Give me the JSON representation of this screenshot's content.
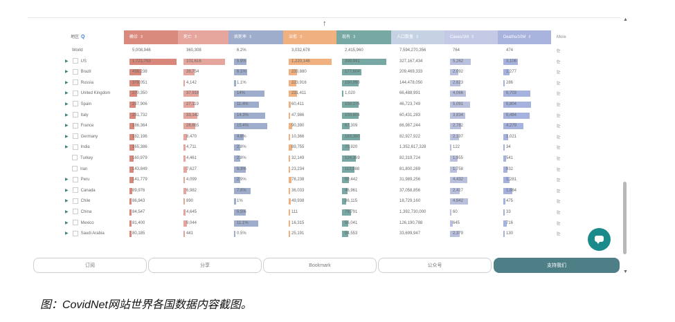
{
  "caption": "图：CovidNet网站世界各国数据内容截图。",
  "colors": {
    "cases": "#d9877a",
    "deaths": "#e5a49c",
    "fatality": "#9eadcc",
    "recovered": "#f0b07f",
    "active": "#77a8a3",
    "population": "#b8c6d9",
    "cases_per_m": "#b8c0de",
    "deaths_per_m": "#a6b2de",
    "support_btn": "#4f7f86",
    "fab": "#1a8a8a"
  },
  "table": {
    "headers": {
      "region": "地区",
      "cases": "确诊",
      "deaths": "死亡",
      "fatality": "病死率",
      "recovered": "治愈",
      "active": "现有",
      "population": "人口数量",
      "cases_per_m": "Cases/1M",
      "deaths_per_m": "Deaths/10M",
      "more": "More"
    },
    "rows": [
      {
        "name": "World",
        "cases": "5,008,946",
        "deaths": "360,308",
        "fatality": "6.2%",
        "recovered": "3,032,678",
        "active": "2,415,960",
        "population": "7,594,270,356",
        "cases_per_m": "764",
        "deaths_per_m": "474"
      },
      {
        "name": "US",
        "cases": "1,721,753",
        "deaths": "101,616",
        "fatality": "5.9%",
        "recovered": "1,220,146",
        "active": "399,991",
        "population": "327,167,434",
        "cases_per_m": "5,262",
        "deaths_per_m": "3,106"
      },
      {
        "name": "Brazil",
        "cases": "438,238",
        "deaths": "26,754",
        "fatality": "6.1%",
        "recovered": "233,880",
        "active": "177,604",
        "population": "209,469,333",
        "cases_per_m": "2,092",
        "deaths_per_m": "1,277"
      },
      {
        "name": "Russia",
        "cases": "379,051",
        "deaths": "4,142",
        "fatality": "1.1%",
        "recovered": "223,916",
        "active": "150,993",
        "population": "144,478,050",
        "cases_per_m": "2,623",
        "deaths_per_m": "286"
      },
      {
        "name": "United Kingdom",
        "cases": "270,350",
        "deaths": "37,919",
        "fatality": "14%",
        "recovered": "231,411",
        "active": "1,020",
        "population": "66,488,991",
        "cases_per_m": "4,066",
        "deaths_per_m": "5,703"
      },
      {
        "name": "Spain",
        "cases": "237,906",
        "deaths": "27,119",
        "fatality": "11.4%",
        "recovered": "60,411",
        "active": "150,376",
        "population": "46,723,749",
        "cases_per_m": "5,091",
        "deaths_per_m": "5,804"
      },
      {
        "name": "Italy",
        "cases": "231,732",
        "deaths": "33,142",
        "fatality": "14.3%",
        "recovered": "47,986",
        "active": "150,604",
        "population": "60,431,283",
        "cases_per_m": "3,834",
        "deaths_per_m": "5,484"
      },
      {
        "name": "France",
        "cases": "186,364",
        "deaths": "28,665",
        "fatality": "15.4%",
        "recovered": "90,390",
        "active": "67,309",
        "population": "66,987,244",
        "cases_per_m": "2,782",
        "deaths_per_m": "4,279"
      },
      {
        "name": "Germany",
        "cases": "182,196",
        "deaths": "8,470",
        "fatality": "4.6%",
        "recovered": "10,366",
        "active": "163,360",
        "population": "82,927,922",
        "cases_per_m": "2,197",
        "deaths_per_m": "1,021"
      },
      {
        "name": "India",
        "cases": "165,386",
        "deaths": "4,711",
        "fatality": "2.8%",
        "recovered": "89,755",
        "active": "70,920",
        "population": "1,352,617,328",
        "cases_per_m": "122",
        "deaths_per_m": "34"
      },
      {
        "name": "Turkey",
        "cases": "160,979",
        "deaths": "4,461",
        "fatality": "2.8%",
        "recovered": "32,149",
        "active": "124,369",
        "population": "82,319,724",
        "cases_per_m": "1,955",
        "deaths_per_m": "541"
      },
      {
        "name": "Iran",
        "cases": "143,849",
        "deaths": "7,627",
        "fatality": "5.3%",
        "recovered": "23,234",
        "active": "112,988",
        "population": "81,800,269",
        "cases_per_m": "1,758",
        "deaths_per_m": "932"
      },
      {
        "name": "Peru",
        "cases": "141,779",
        "deaths": "4,099",
        "fatality": "2.9%",
        "recovered": "78,238",
        "active": "59,442",
        "population": "31,989,256",
        "cases_per_m": "4,432",
        "deaths_per_m": "1,281"
      },
      {
        "name": "Canada",
        "cases": "89,976",
        "deaths": "6,982",
        "fatality": "7.8%",
        "recovered": "36,033",
        "active": "46,961",
        "population": "37,058,856",
        "cases_per_m": "2,427",
        "deaths_per_m": "1,884"
      },
      {
        "name": "Chile",
        "cases": "86,943",
        "deaths": "890",
        "fatality": "1%",
        "recovered": "49,938",
        "active": "36,115",
        "population": "18,729,160",
        "cases_per_m": "4,642",
        "deaths_per_m": "475"
      },
      {
        "name": "China",
        "cases": "84,547",
        "deaths": "4,645",
        "fatality": "5.5%",
        "recovered": "111",
        "active": "79,791",
        "population": "1,392,730,000",
        "cases_per_m": "60",
        "deaths_per_m": "33"
      },
      {
        "name": "Mexico",
        "cases": "81,400",
        "deaths": "9,044",
        "fatality": "11.1%",
        "recovered": "16,315",
        "active": "56,041",
        "population": "126,190,788",
        "cases_per_m": "645",
        "deaths_per_m": "716"
      },
      {
        "name": "Saudi Arabia",
        "cases": "80,185",
        "deaths": "441",
        "fatality": "0.5%",
        "recovered": "25,191",
        "active": "54,553",
        "population": "33,699,947",
        "cases_per_m": "2,379",
        "deaths_per_m": "130"
      }
    ]
  },
  "buttons": {
    "subscribe": "订阅",
    "share": "分享",
    "bookmark": "Bookmark",
    "official_account": "公众号",
    "support": "支持我们"
  }
}
